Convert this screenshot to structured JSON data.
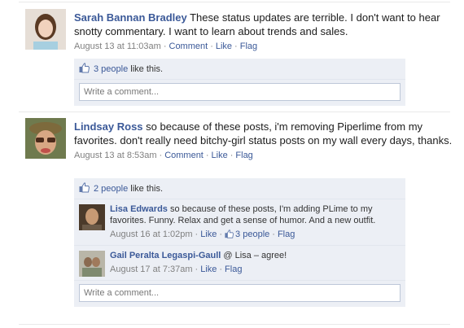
{
  "posts": [
    {
      "author": "Sarah Bannan Bradley",
      "text": "These status updates are terrible. I don't want to hear snotty commentary. I want to learn about trends and sales.",
      "timestamp": "August 13 at 11:03am",
      "comment_label": "Comment",
      "like_label": "Like",
      "flag_label": "Flag",
      "likes_count": "3 people",
      "likes_suffix": "like this.",
      "comment_placeholder": "Write a comment..."
    },
    {
      "author": "Lindsay Ross",
      "text": "so because of these posts, i'm removing Piperlime from my favorites. don't really need bitchy-girl status posts on my wall every days, thanks.",
      "timestamp": "August 13 at 8:53am",
      "comment_label": "Comment",
      "like_label": "Like",
      "flag_label": "Flag",
      "likes_count": "2 people",
      "likes_suffix": "like this.",
      "comment_placeholder": "Write a comment...",
      "replies": [
        {
          "author": "Lisa Edwards",
          "text": "so because of these posts, I'm adding PLime to my favorites. Funny. Relax and get a sense of humor. And a new outfit.",
          "timestamp": "August 16 at 1:02pm",
          "like_label": "Like",
          "likes_count": "3 people",
          "flag_label": "Flag"
        },
        {
          "author": "Gail Peralta Legaspi-Gaull",
          "text": "@ Lisa – agree!",
          "timestamp": "August 17 at 7:37am",
          "like_label": "Like",
          "flag_label": "Flag"
        }
      ]
    }
  ],
  "colors": {
    "link": "#3b5998",
    "ufi_bg": "#eceff5",
    "meta": "#808080"
  }
}
